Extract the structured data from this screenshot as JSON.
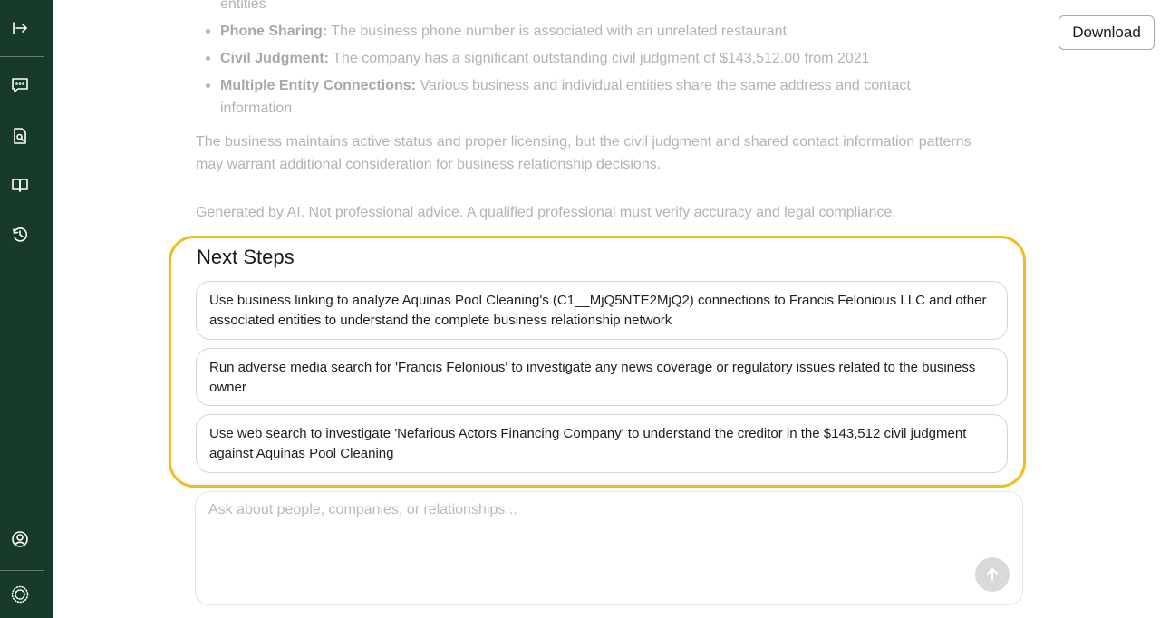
{
  "sidebar": {
    "icons": [
      "expand-sidebar-icon",
      "chat-icon",
      "document-search-icon",
      "book-icon",
      "history-icon",
      "user-profile-icon",
      "logo-icon"
    ]
  },
  "toolbar": {
    "download_label": "Download"
  },
  "previous_message": {
    "bullet_cut": "entities",
    "bullets": [
      {
        "title": "Phone Sharing:",
        "text": " The business phone number is associated with an unrelated restaurant"
      },
      {
        "title": "Civil Judgment:",
        "text": " The company has a significant outstanding civil judgment of $143,512.00 from 2021"
      },
      {
        "title": "Multiple Entity Connections:",
        "text": " Various business and individual entities share the same address and contact information"
      }
    ],
    "summary": "The business maintains active status and proper licensing, but the civil judgment and shared contact information patterns may warrant additional consideration for business relationship decisions.",
    "disclaimer": "Generated by AI. Not professional advice. A qualified professional must verify accuracy and legal compliance."
  },
  "next_steps": {
    "title": "Next Steps",
    "items": [
      "Use business linking to analyze Aquinas Pool Cleaning's (C1__MjQ5NTE2MjQ2) connections to Francis Felonious LLC and other associated entities to understand the complete business relationship network",
      "Run adverse media search for 'Francis Felonious' to investigate any news coverage or regulatory issues related to the business owner",
      "Use web search to investigate 'Nefarious Actors Financing Company' to understand the creditor in the $143,512 civil judgment against Aquinas Pool Cleaning"
    ]
  },
  "chat": {
    "placeholder": "Ask about people, companies, or relationships...",
    "value": ""
  },
  "colors": {
    "sidebar_bg": "#173a2b",
    "highlight_border": "#f2bd1c",
    "send_button_disabled": "#d9d9d9"
  }
}
